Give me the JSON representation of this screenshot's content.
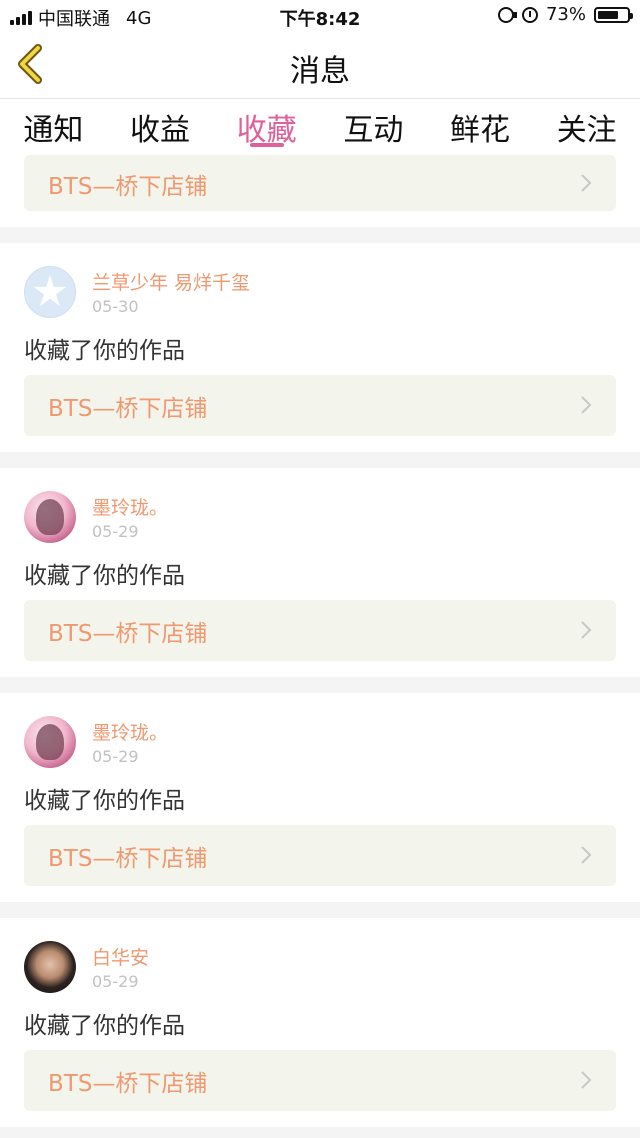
{
  "status_bar": {
    "carrier": "中国联通",
    "network": "4G",
    "time": "下午8:42",
    "battery_percent": "73%",
    "battery_level": 0.73
  },
  "nav": {
    "title": "消息",
    "back_icon": "chevron-left-icon"
  },
  "tabs": [
    {
      "label": "通知",
      "active": false
    },
    {
      "label": "收益",
      "active": false
    },
    {
      "label": "收藏",
      "active": true
    },
    {
      "label": "互动",
      "active": false
    },
    {
      "label": "鲜花",
      "active": false
    },
    {
      "label": "关注",
      "active": false
    }
  ],
  "top_item": {
    "work_title": "BTS—桥下店铺"
  },
  "messages": [
    {
      "user": "兰草少年 易烊千玺",
      "date": "05-30",
      "action": "收藏了你的作品",
      "work_title": "BTS—桥下店铺",
      "avatar": "default-avatar"
    },
    {
      "user": "墨玲珑。",
      "date": "05-29",
      "action": "收藏了你的作品",
      "work_title": "BTS—桥下店铺",
      "avatar": "anime-avatar"
    },
    {
      "user": "墨玲珑。",
      "date": "05-29",
      "action": "收藏了你的作品",
      "work_title": "BTS—桥下店铺",
      "avatar": "anime-avatar"
    },
    {
      "user": "白华安",
      "date": "05-29",
      "action": "收藏了你的作品",
      "work_title": "BTS—桥下店铺",
      "avatar": "photo-avatar"
    }
  ],
  "colors": {
    "accent_pink": "#e0609c",
    "name_orange": "#f0986f",
    "card_bg": "#f3f4ec",
    "divider_bg": "#f4f4f4"
  }
}
